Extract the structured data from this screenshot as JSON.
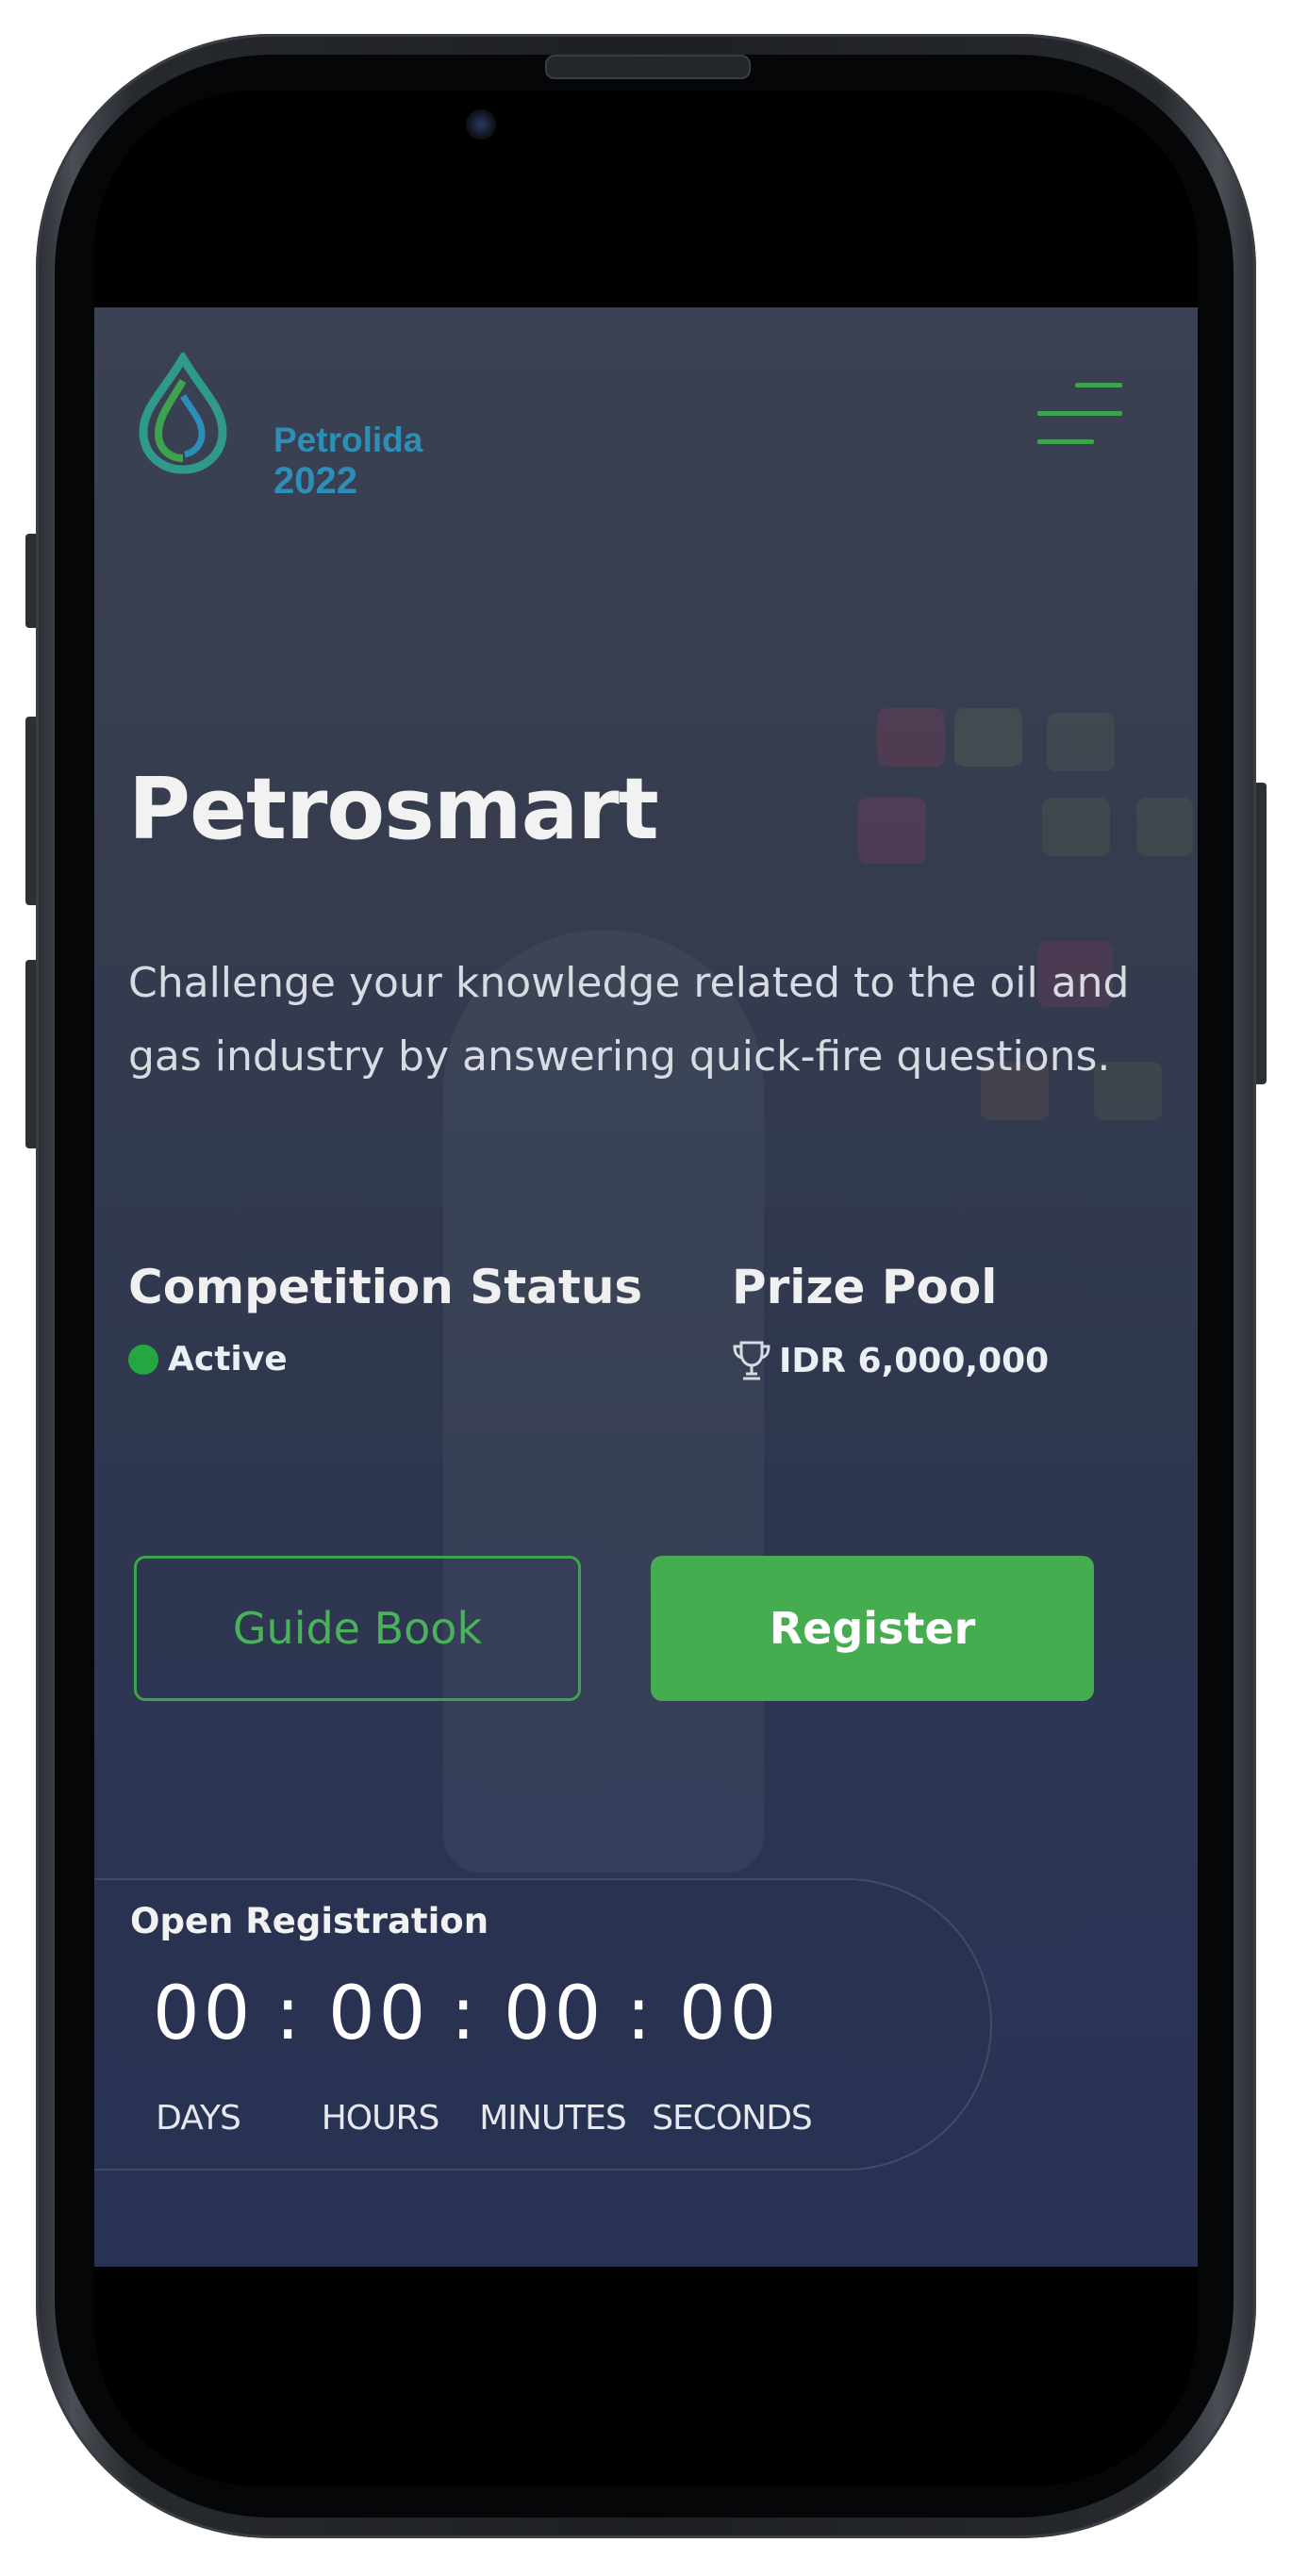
{
  "brand": {
    "name": "Petrolida",
    "year": "2022",
    "colors": {
      "primary": "#2d8fb8",
      "accent": "#3ea34e"
    }
  },
  "nav": {
    "menu_icon": "hamburger-menu-icon"
  },
  "hero": {
    "title": "Petrosmart",
    "description": "Challenge your knowledge related to the oil and gas industry by answering quick-fire questions."
  },
  "info": {
    "status_label": "Competition Status",
    "status_value": "Active",
    "status_color": "#26a641",
    "prize_label": "Prize Pool",
    "prize_value": "IDR 6,000,000",
    "prize_icon": "trophy-icon"
  },
  "buttons": {
    "guide_book": "Guide Book",
    "register": "Register"
  },
  "countdown": {
    "label": "Open Registration",
    "separator": ":",
    "units": [
      {
        "value": "00",
        "name": "DAYS"
      },
      {
        "value": "00",
        "name": "HOURS"
      },
      {
        "value": "00",
        "name": "MINUTES"
      },
      {
        "value": "00",
        "name": "SECONDS"
      }
    ]
  }
}
